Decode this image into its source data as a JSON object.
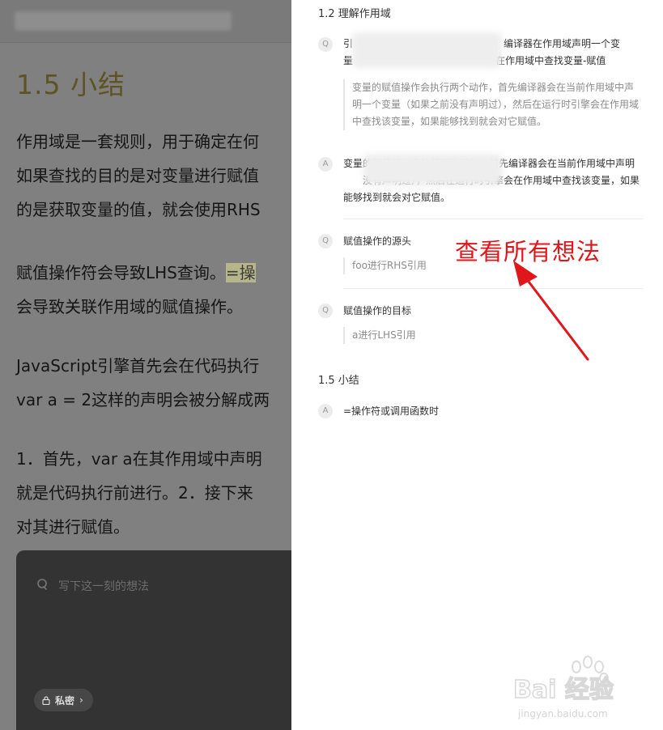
{
  "reader": {
    "chapter_title": "1.5 小结",
    "paragraphs": {
      "p1": "作用域是一套规则，用于确定在何\n如果查找的目的是对变量进行赋值\n的是获取变量的值，就会使用RHS",
      "p2_a": "赋值操作符会导致LHS查询。",
      "p2_hl": "=操",
      "p2_b": "\n会导致关联作用域的赋值操作。",
      "p3": "JavaScript引擎首先会在代码执行\nvar a = 2这样的声明会被分解成两",
      "p4": "1．首先，var a在其作用域中声明\n就是代码执行前进行。2．接下来\n对其进行赋值。"
    },
    "note_placeholder": "写下这一刻的想法",
    "private_label": "私密"
  },
  "panel": {
    "section1_title": "1.2 理解作用域",
    "item1": {
      "badge": "Q",
      "text_a": "引",
      "text_b": "编译器在作用域声明一个变",
      "text_c": "量",
      "text_d": "在作用域中查找变量-赋值",
      "quote": "变量的赋值操作会执行两个动作，首先编译器会在当前作用域中声明一个变量（如果之前没有声明过），然后在运行时引擎会在作用域中查找该变量，如果能够找到就会对它赋值。"
    },
    "item2": {
      "badge": "A",
      "text_a": "变量的赋值操作会执行两个动作，首先编译器会在当前作用域中声明",
      "text_b": "没有声明过），然后在运行时引擎会在作用域中查找该变量，如果能够找到就会对它赋值。"
    },
    "item3": {
      "badge": "Q",
      "text": "赋值操作的源头",
      "quote": "foo进行RHS引用"
    },
    "item4": {
      "badge": "Q",
      "text": "赋值操作的目标",
      "quote": "a进行LHS引用"
    },
    "section2_title": "1.5 小结",
    "item5": {
      "badge": "A",
      "text": "=操作符或调用函数时"
    }
  },
  "annotation": "查看所有想法",
  "watermark": {
    "brand": "Bai 经验",
    "url": "jingyan.baidu.com"
  },
  "colors": {
    "annotation": "#e0161a",
    "highlight": "#b6b68a",
    "chapter_title": "#5d5324"
  }
}
